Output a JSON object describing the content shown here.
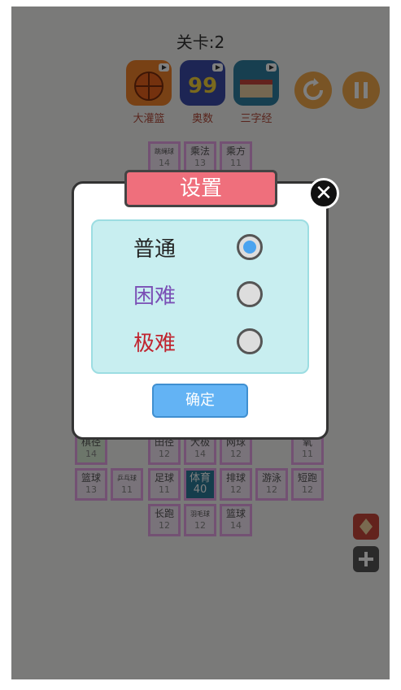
{
  "level": {
    "title": "关卡:2"
  },
  "promo_games": [
    {
      "label": "大灌篮",
      "icon": "basketball-game-icon",
      "color": "#f0832a"
    },
    {
      "label": "奥数",
      "icon": "math-99-game-icon",
      "color": "#3a4aa8"
    },
    {
      "label": "三字经",
      "icon": "book-game-icon",
      "color": "#2f7ea0"
    }
  ],
  "controls": {
    "restart_icon": "restart-icon",
    "pause_icon": "pause-icon",
    "accent": "#f2a94a"
  },
  "tiles": [
    {
      "name": "跳绳球",
      "count": "14"
    },
    {
      "name": "乘法",
      "count": "13"
    },
    {
      "name": "乘方",
      "count": "11"
    },
    {
      "name": "棋径",
      "count": "14"
    },
    {
      "name": "田径",
      "count": "12"
    },
    {
      "name": "大极",
      "count": "14"
    },
    {
      "name": "网球",
      "count": "12"
    },
    {
      "name": "氧",
      "count": "11"
    },
    {
      "name": "篮球",
      "count": "13"
    },
    {
      "name": "乒乓球",
      "count": "11"
    },
    {
      "name": "足球",
      "count": "11"
    },
    {
      "name": "体育",
      "count": "40"
    },
    {
      "name": "排球",
      "count": "12"
    },
    {
      "name": "游泳",
      "count": "12"
    },
    {
      "name": "短跑",
      "count": "12"
    },
    {
      "name": "长跑",
      "count": "12"
    },
    {
      "name": "羽毛球",
      "count": "12"
    },
    {
      "name": "篮球",
      "count": "14"
    }
  ],
  "settings_dialog": {
    "title": "设置",
    "options": [
      {
        "label": "普通",
        "selected": true,
        "color": "#222222"
      },
      {
        "label": "困难",
        "selected": false,
        "color": "#7a4fb5"
      },
      {
        "label": "极难",
        "selected": false,
        "color": "#c0242f"
      }
    ],
    "confirm_label": "确定"
  }
}
